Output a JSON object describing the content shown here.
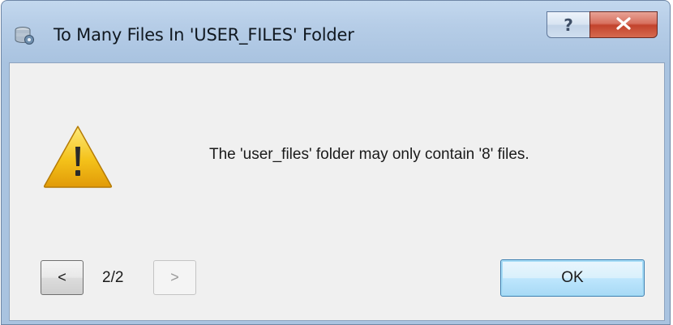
{
  "window": {
    "title": "To Many Files In 'USER_FILES' Folder",
    "help_label": "?",
    "app_icon": "database-settings-icon",
    "close_icon": "close-icon"
  },
  "dialog": {
    "icon": "warning-icon",
    "message": "The 'user_files' folder may only contain '8' files."
  },
  "navigation": {
    "prev_label": "<",
    "next_label": ">",
    "page_indicator": "2/2"
  },
  "buttons": {
    "ok_label": "OK"
  },
  "colors": {
    "titlebar": "#b6cde7",
    "client_bg": "#f0f0f0",
    "close_red": "#c2432c",
    "ok_border": "#3c7fb1",
    "warning_yellow": "#f4c21a"
  }
}
